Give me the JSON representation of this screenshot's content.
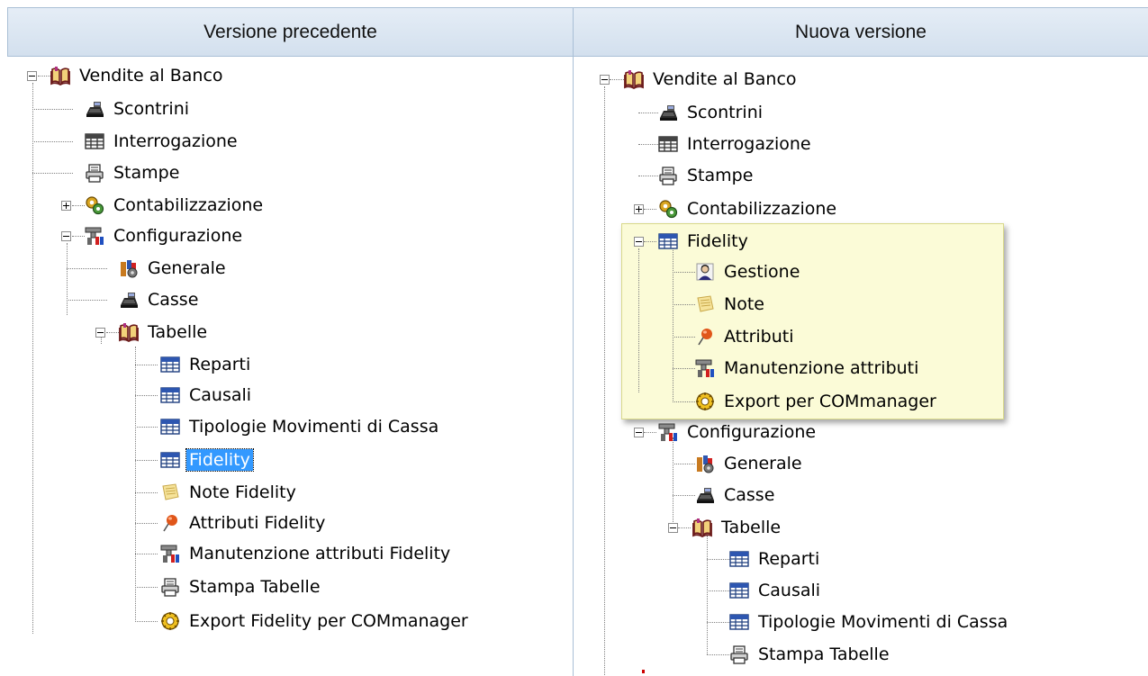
{
  "headers": {
    "left": "Versione precedente",
    "right": "Nuova versione"
  },
  "colors": {
    "header_bg": "#dce6f1",
    "selection": "#3399ff",
    "highlight_bg": "#fbfbd7"
  },
  "left_tree": {
    "root": "Vendite al Banco",
    "items": {
      "scontrini": "Scontrini",
      "interrogazione": "Interrogazione",
      "stampe": "Stampe",
      "contabilizzazione": "Contabilizzazione",
      "configurazione": "Configurazione",
      "generale": "Generale",
      "casse": "Casse",
      "tabelle": "Tabelle",
      "reparti": "Reparti",
      "causali": "Causali",
      "tipologie": "Tipologie Movimenti di Cassa",
      "fidelity": "Fidelity",
      "note_fidelity": "Note Fidelity",
      "attributi_fidelity": "Attributi Fidelity",
      "manutenzione": "Manutenzione attributi Fidelity",
      "stampa_tabelle": "Stampa Tabelle",
      "export": "Export Fidelity per COMmanager"
    }
  },
  "right_tree": {
    "root": "Vendite al Banco",
    "items": {
      "scontrini": "Scontrini",
      "interrogazione": "Interrogazione",
      "stampe": "Stampe",
      "contabilizzazione": "Contabilizzazione",
      "fidelity": "Fidelity",
      "gestione": "Gestione",
      "note": "Note",
      "attributi": "Attributi",
      "manutenzione": "Manutenzione attributi",
      "export": "Export per COMmanager",
      "configurazione": "Configurazione",
      "generale": "Generale",
      "casse": "Casse",
      "tabelle": "Tabelle",
      "reparti": "Reparti",
      "causali": "Causali",
      "tipologie": "Tipologie Movimenti di Cassa",
      "stampa_tabelle": "Stampa Tabelle"
    }
  }
}
